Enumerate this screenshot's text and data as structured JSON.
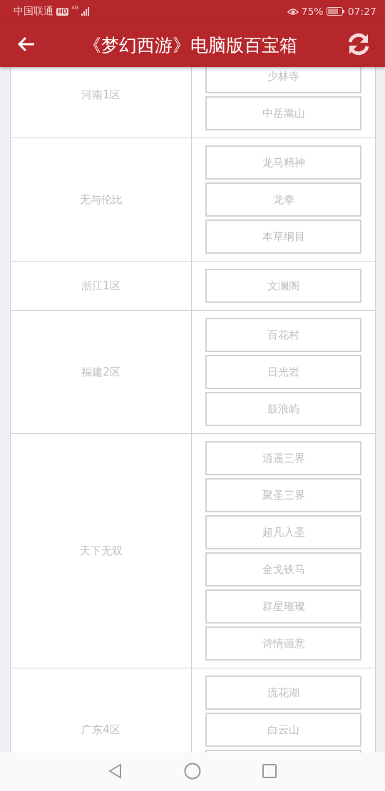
{
  "status_bar": {
    "carrier": "中国联通",
    "hd_badge": "HD",
    "network": "4G",
    "battery": "75%",
    "time": "07:27"
  },
  "header": {
    "title": "《梦幻西游》电脑版百宝箱"
  },
  "groups": [
    {
      "name": "河南1区",
      "servers": [
        {
          "kind": "server",
          "label": "少林寺"
        },
        {
          "kind": "server",
          "label": "中岳嵩山"
        }
      ]
    },
    {
      "name": "无与伦比",
      "servers": [
        {
          "kind": "server",
          "label": "龙马精神"
        },
        {
          "kind": "server",
          "label": "龙拳"
        },
        {
          "kind": "server",
          "label": "本草纲目"
        }
      ]
    },
    {
      "name": "浙江1区",
      "servers": [
        {
          "kind": "server",
          "label": "文澜阁"
        }
      ]
    },
    {
      "name": "福建2区",
      "servers": [
        {
          "kind": "server",
          "label": "百花村"
        },
        {
          "kind": "server",
          "label": "日光岩"
        },
        {
          "kind": "server",
          "label": "鼓浪屿"
        }
      ]
    },
    {
      "name": "天下无双",
      "servers": [
        {
          "kind": "server",
          "label": "逍遥三界"
        },
        {
          "kind": "server",
          "label": "聚圣三界"
        },
        {
          "kind": "server",
          "label": "超凡入圣"
        },
        {
          "kind": "server",
          "label": "金戈铁马"
        },
        {
          "kind": "server",
          "label": "群星璀璨"
        },
        {
          "kind": "server",
          "label": "诗情画意"
        }
      ]
    },
    {
      "name": "广东4区",
      "servers": [
        {
          "kind": "server",
          "label": "流花湖"
        },
        {
          "kind": "server",
          "label": "白云山"
        },
        {
          "kind": "cut"
        }
      ]
    }
  ]
}
